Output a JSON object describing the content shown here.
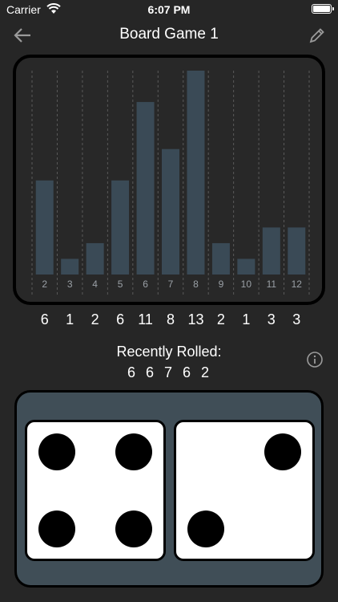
{
  "status": {
    "carrier": "Carrier",
    "time": "6:07 PM"
  },
  "nav": {
    "title": "Board Game 1",
    "back_icon": "arrow-left-icon",
    "edit_icon": "pencil-icon"
  },
  "chart_data": {
    "type": "bar",
    "categories": [
      "2",
      "3",
      "4",
      "5",
      "6",
      "7",
      "8",
      "9",
      "10",
      "11",
      "12"
    ],
    "values": [
      6,
      1,
      2,
      6,
      11,
      8,
      13,
      2,
      1,
      3,
      3
    ],
    "ylim": [
      0,
      13
    ],
    "grid": true,
    "colors": {
      "bar": "#3a4a56",
      "tick": "#9aa0a6",
      "grid": "#5a5a5a"
    }
  },
  "counts": [
    "6",
    "1",
    "2",
    "6",
    "11",
    "8",
    "13",
    "2",
    "1",
    "3",
    "3"
  ],
  "recent": {
    "title": "Recently Rolled:",
    "values": "6 6 7 6 2"
  },
  "dice": [
    {
      "value": 4
    },
    {
      "value": 2
    }
  ],
  "colors": {
    "background": "#262626",
    "tray": "#404e57",
    "die_face": "#ffffff",
    "pip": "#000000"
  }
}
